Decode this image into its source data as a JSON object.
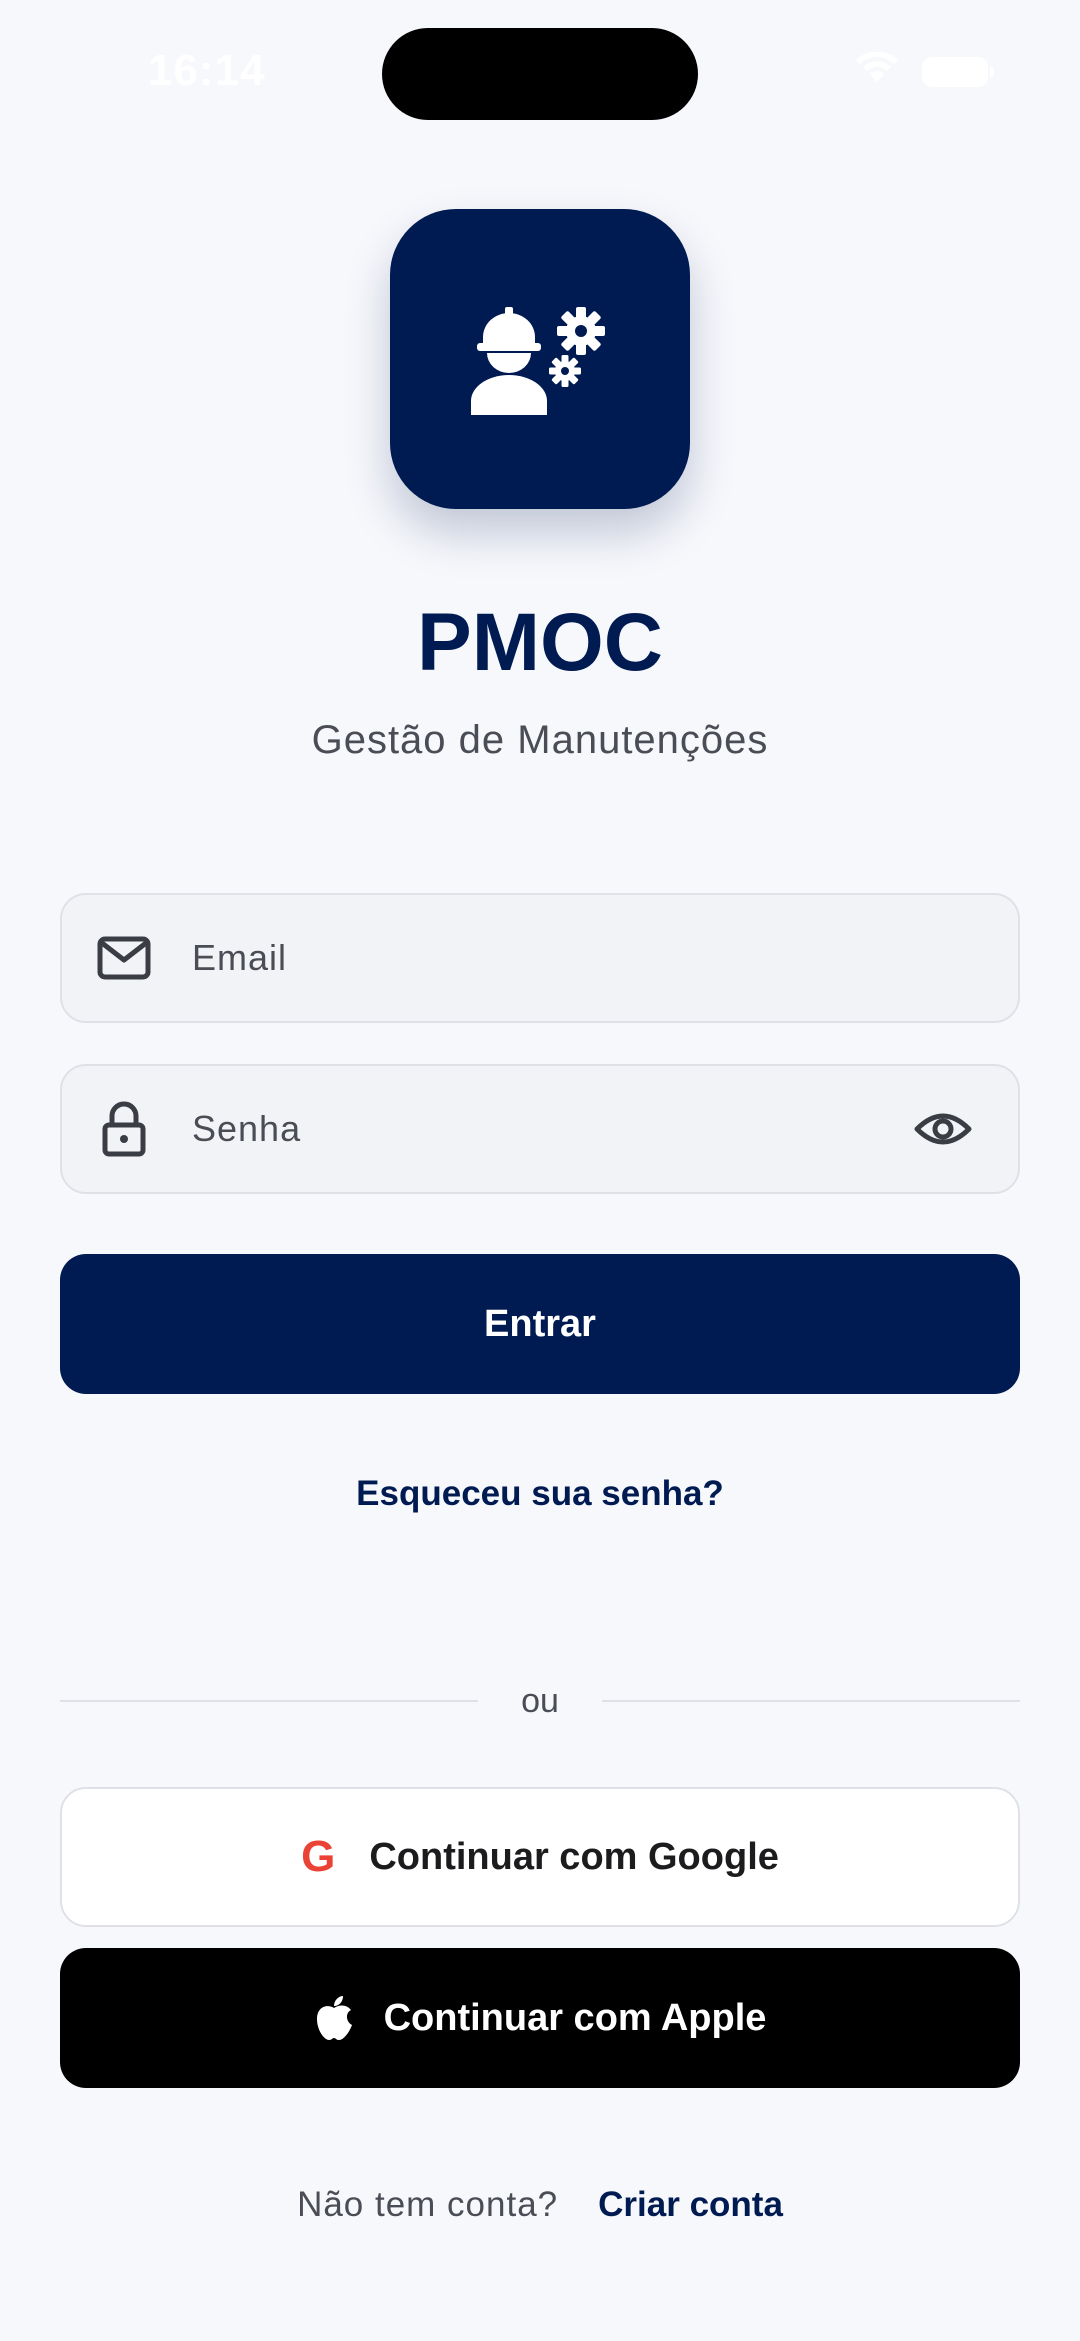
{
  "status_bar": {
    "time": "16:14",
    "wifi_icon": "wifi-icon",
    "battery_icon": "battery-icon"
  },
  "app": {
    "title": "PMOC",
    "subtitle": "Gestão de Manutenções",
    "logo_icon": "worker-gears-icon"
  },
  "form": {
    "email": {
      "placeholder": "Email",
      "value": "",
      "icon": "mail-icon"
    },
    "password": {
      "placeholder": "Senha",
      "value": "",
      "icon": "lock-icon",
      "toggle_icon": "eye-icon"
    },
    "submit_label": "Entrar",
    "forgot_label": "Esqueceu sua senha?"
  },
  "divider_label": "ou",
  "social": {
    "google_letter": "G",
    "google_label": "Continuar com Google",
    "apple_label": "Continuar com Apple"
  },
  "footer": {
    "question": "Não tem conta?",
    "signup_label": "Criar conta"
  },
  "colors": {
    "primary": "#001a52",
    "background": "#f7f8fc",
    "google_red": "#ea4335"
  }
}
